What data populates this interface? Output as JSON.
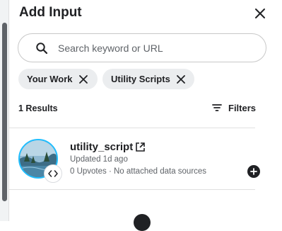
{
  "dialog": {
    "title": "Add Input"
  },
  "search": {
    "placeholder": "Search keyword or URL",
    "value": ""
  },
  "chips": [
    {
      "label": "Your Work"
    },
    {
      "label": "Utility Scripts"
    }
  ],
  "results": {
    "count_label": "1 Results",
    "filters_label": "Filters"
  },
  "items": [
    {
      "title": "utility_script",
      "updated": "Updated 1d ago",
      "meta": "0 Upvotes · No attached data sources"
    }
  ],
  "colors": {
    "accent": "#20beff",
    "text": "#202124",
    "muted": "#5f6368",
    "chip_bg": "#ebedef"
  },
  "icons": [
    "close-icon",
    "search-icon",
    "chip-remove-icon",
    "filter-icon",
    "external-link-icon",
    "code-icon",
    "add-icon"
  ]
}
